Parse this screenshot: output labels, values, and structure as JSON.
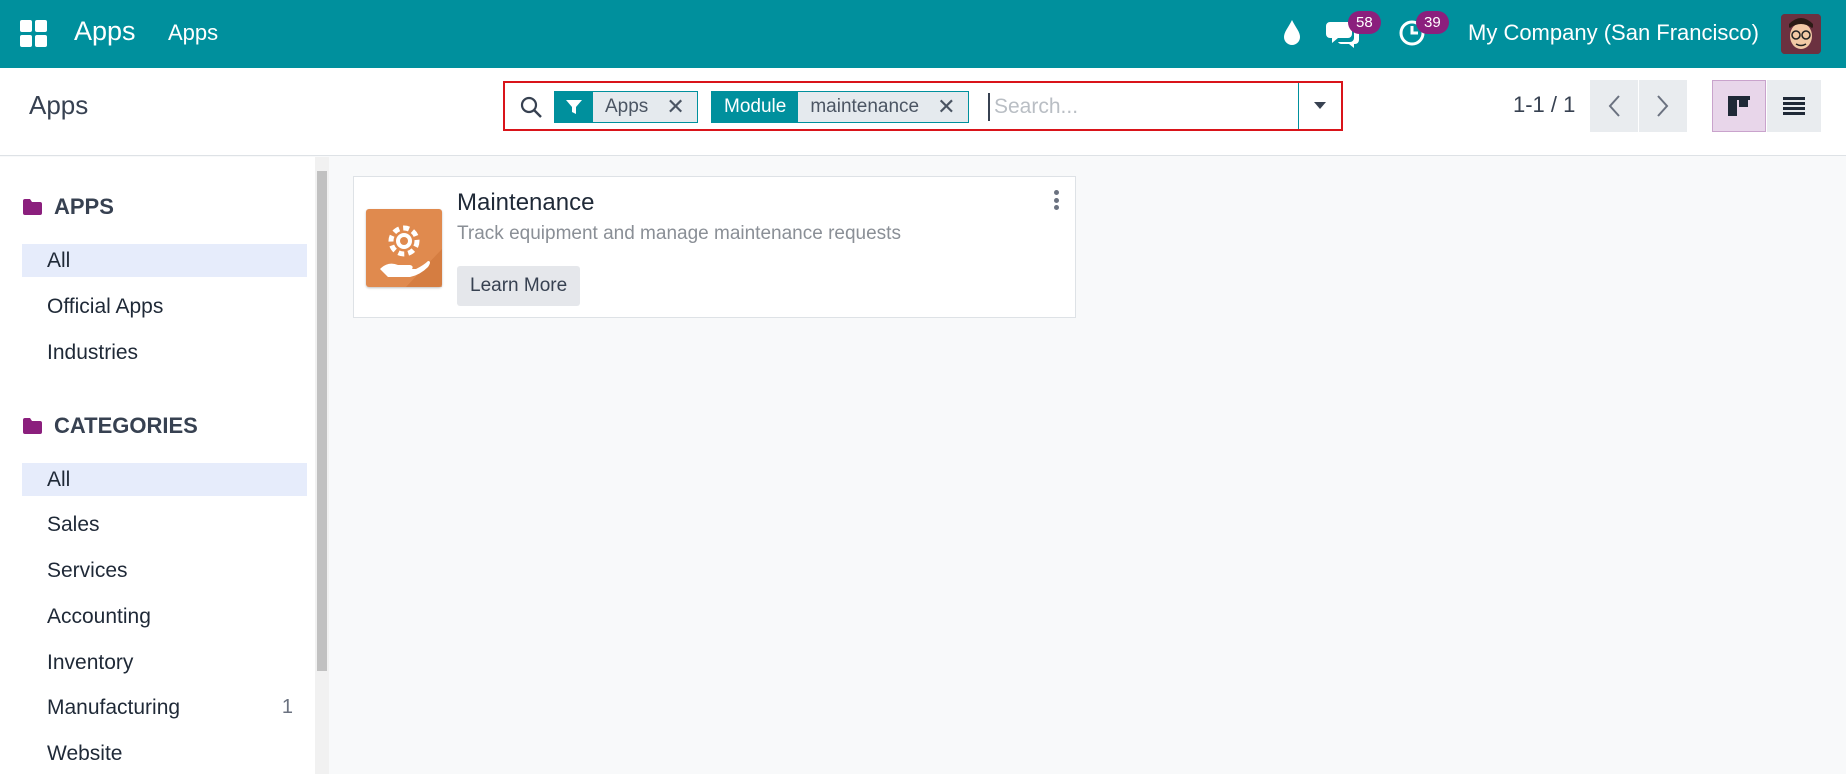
{
  "topbar": {
    "brand": "Apps",
    "menu_apps": "Apps",
    "messages_count": "58",
    "activities_count": "39",
    "company": "My Company (San Francisco)",
    "accent": "#00909d",
    "badge_color": "#8b1f7d",
    "icons": [
      "app-grid-icon",
      "droplet-icon",
      "chat-icon",
      "clock-icon",
      "avatar"
    ]
  },
  "control": {
    "title": "Apps",
    "search": {
      "facets": [
        {
          "label": "",
          "icon": "filter-icon",
          "value": "Apps"
        },
        {
          "label": "Module",
          "value": "maintenance"
        }
      ],
      "placeholder": "Search..."
    },
    "pager": "1-1 / 1",
    "views": [
      "kanban",
      "list"
    ]
  },
  "sidebar": {
    "sections": [
      {
        "title": "APPS",
        "items": [
          {
            "label": "All",
            "active": true
          },
          {
            "label": "Official Apps"
          },
          {
            "label": "Industries"
          }
        ]
      },
      {
        "title": "CATEGORIES",
        "items": [
          {
            "label": "All",
            "active": true
          },
          {
            "label": "Sales"
          },
          {
            "label": "Services"
          },
          {
            "label": "Accounting"
          },
          {
            "label": "Inventory"
          },
          {
            "label": "Manufacturing",
            "count": "1"
          },
          {
            "label": "Website"
          }
        ]
      }
    ]
  },
  "cards": [
    {
      "title": "Maintenance",
      "description": "Track equipment and manage maintenance requests",
      "button": "Learn More",
      "icon_color": "#e08a4e"
    }
  ]
}
